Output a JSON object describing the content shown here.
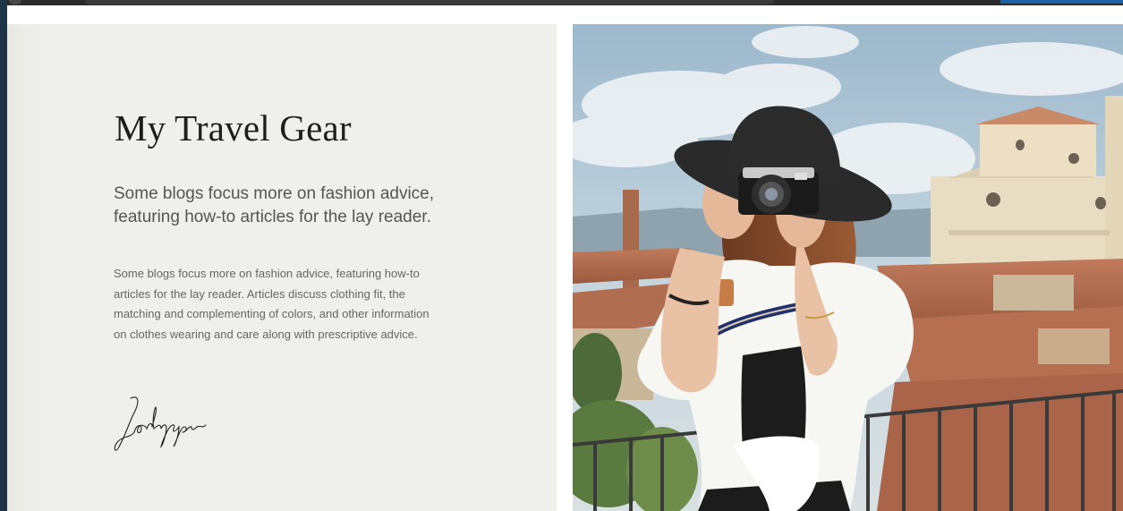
{
  "section": {
    "title": "My Travel Gear",
    "subtitle": "Some blogs focus more on fashion advice, featuring how-to articles for the lay reader.",
    "body": "Some blogs focus more on fashion advice, featuring how-to articles for the lay reader. Articles discuss clothing fit, the matching and complementing of colors, and other information on clothes wearing and care along with prescriptive advice.",
    "signature": "Joebyrapa"
  },
  "photo": {
    "subject": "woman-with-camera-and-hat-on-balcony"
  },
  "colors": {
    "panel_bg": "#efefeb",
    "title": "#1e1e1e",
    "text": "#666666",
    "frame": "#1f3547"
  }
}
